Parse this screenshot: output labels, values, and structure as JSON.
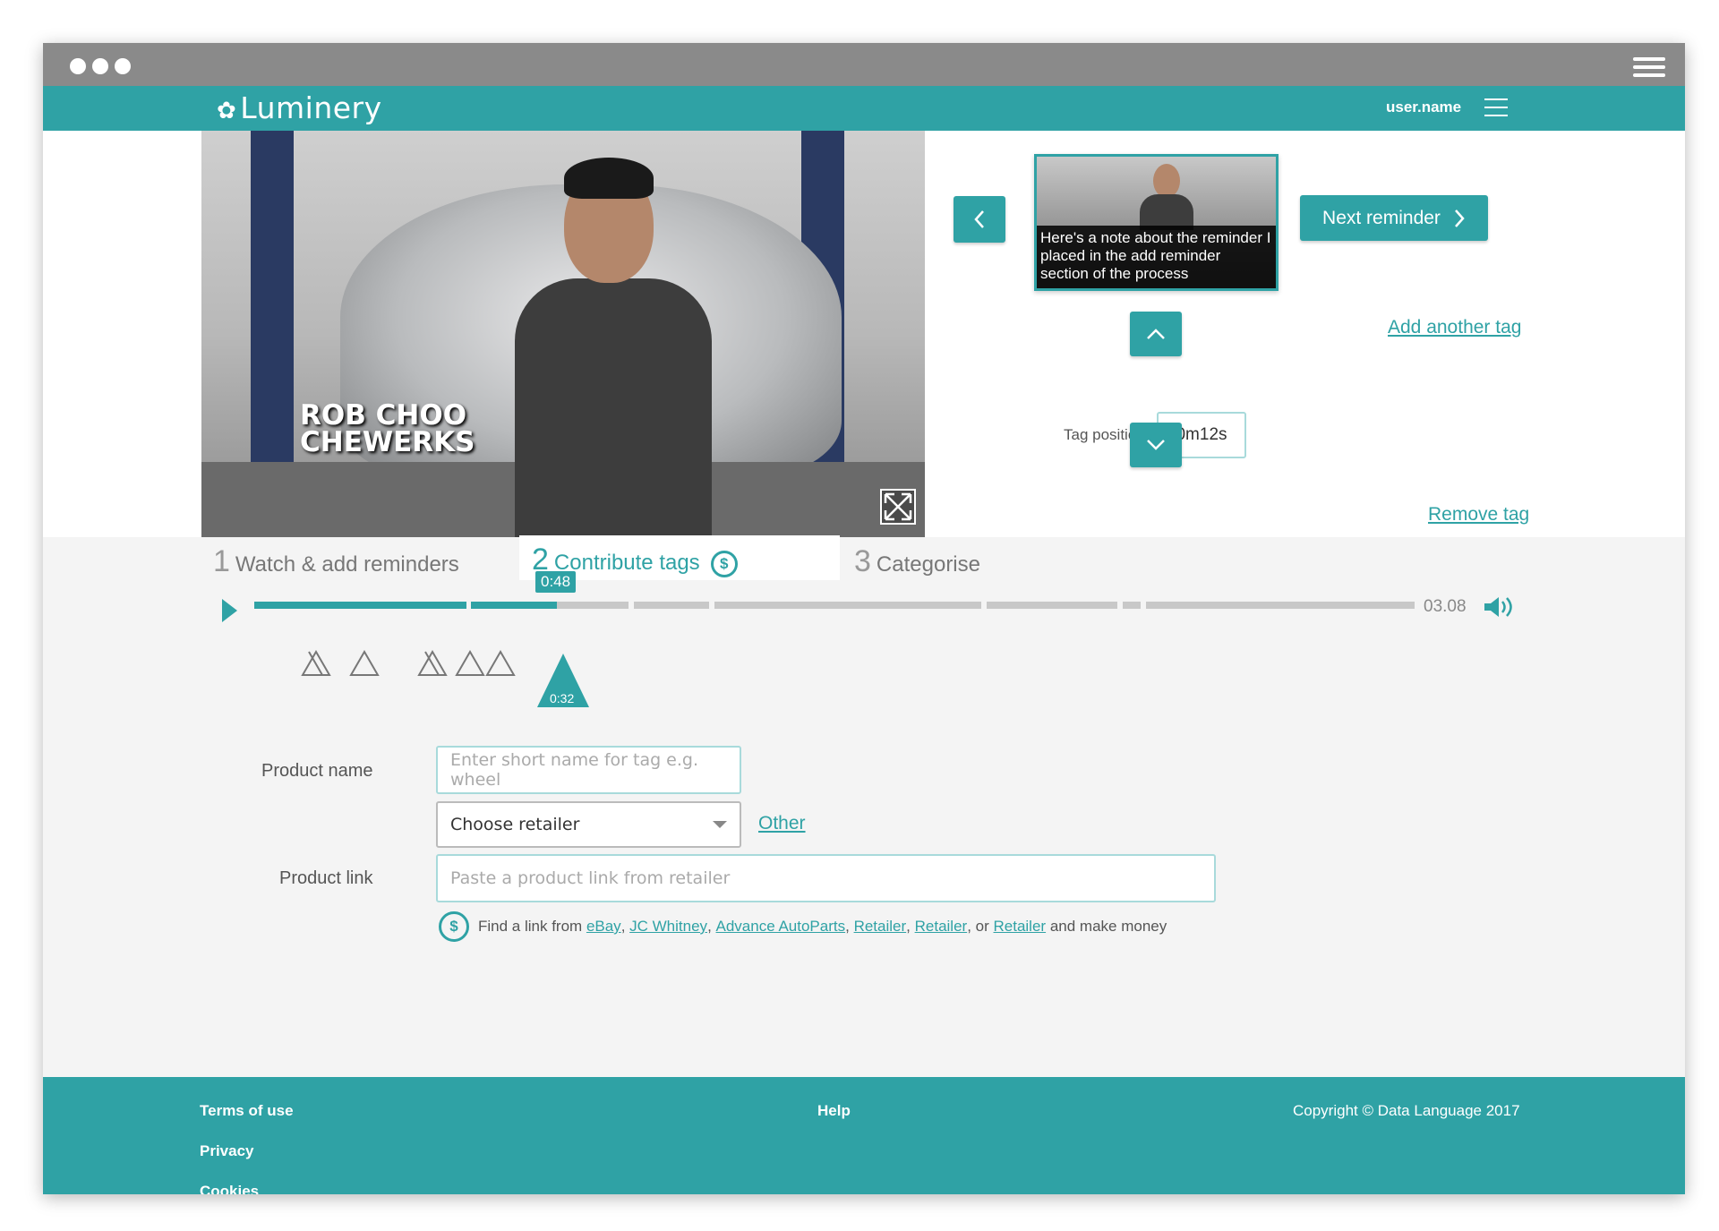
{
  "app": {
    "logo_text": "Luminery",
    "username": "user.name"
  },
  "video": {
    "caption_line1": "ROB CHOO",
    "caption_line2": "CHEWERKS"
  },
  "reminder": {
    "note": "Here's a note about the reminder I placed in the add reminder section of the process",
    "next_label": "Next reminder",
    "add_tag_label": "Add another tag",
    "remove_tag_label": "Remove tag",
    "tag_position_label": "Tag position",
    "tag_position_value": "0m12s"
  },
  "steps": [
    {
      "num": "1",
      "label": "Watch & add reminders"
    },
    {
      "num": "2",
      "label": "Contribute tags"
    },
    {
      "num": "3",
      "label": "Categorise"
    }
  ],
  "timeline": {
    "current_time": "0:48",
    "end_time": "03.08",
    "active_tag_time": "0:32",
    "progress_fraction": 0.26
  },
  "form": {
    "product_name_label": "Product name",
    "product_name_placeholder": "Enter short name for tag e.g. wheel",
    "retailer_selected": "Choose retailer",
    "other_label": "Other",
    "product_link_label": "Product link",
    "product_link_placeholder": "Paste a product link from retailer",
    "hint_prefix": "Find a link from",
    "retailers": [
      "eBay",
      "JC Whitney",
      "Advance AutoParts",
      "Retailer",
      "Retailer",
      "Retailer"
    ],
    "hint_suffix": "and make money"
  },
  "footer": {
    "terms": "Terms of use",
    "privacy": "Privacy",
    "cookies": "Cookies",
    "help": "Help",
    "copyright": "Copyright © Data Language 2017"
  },
  "colors": {
    "accent": "#2fa2a5",
    "chrome": "#8a8a8a"
  }
}
